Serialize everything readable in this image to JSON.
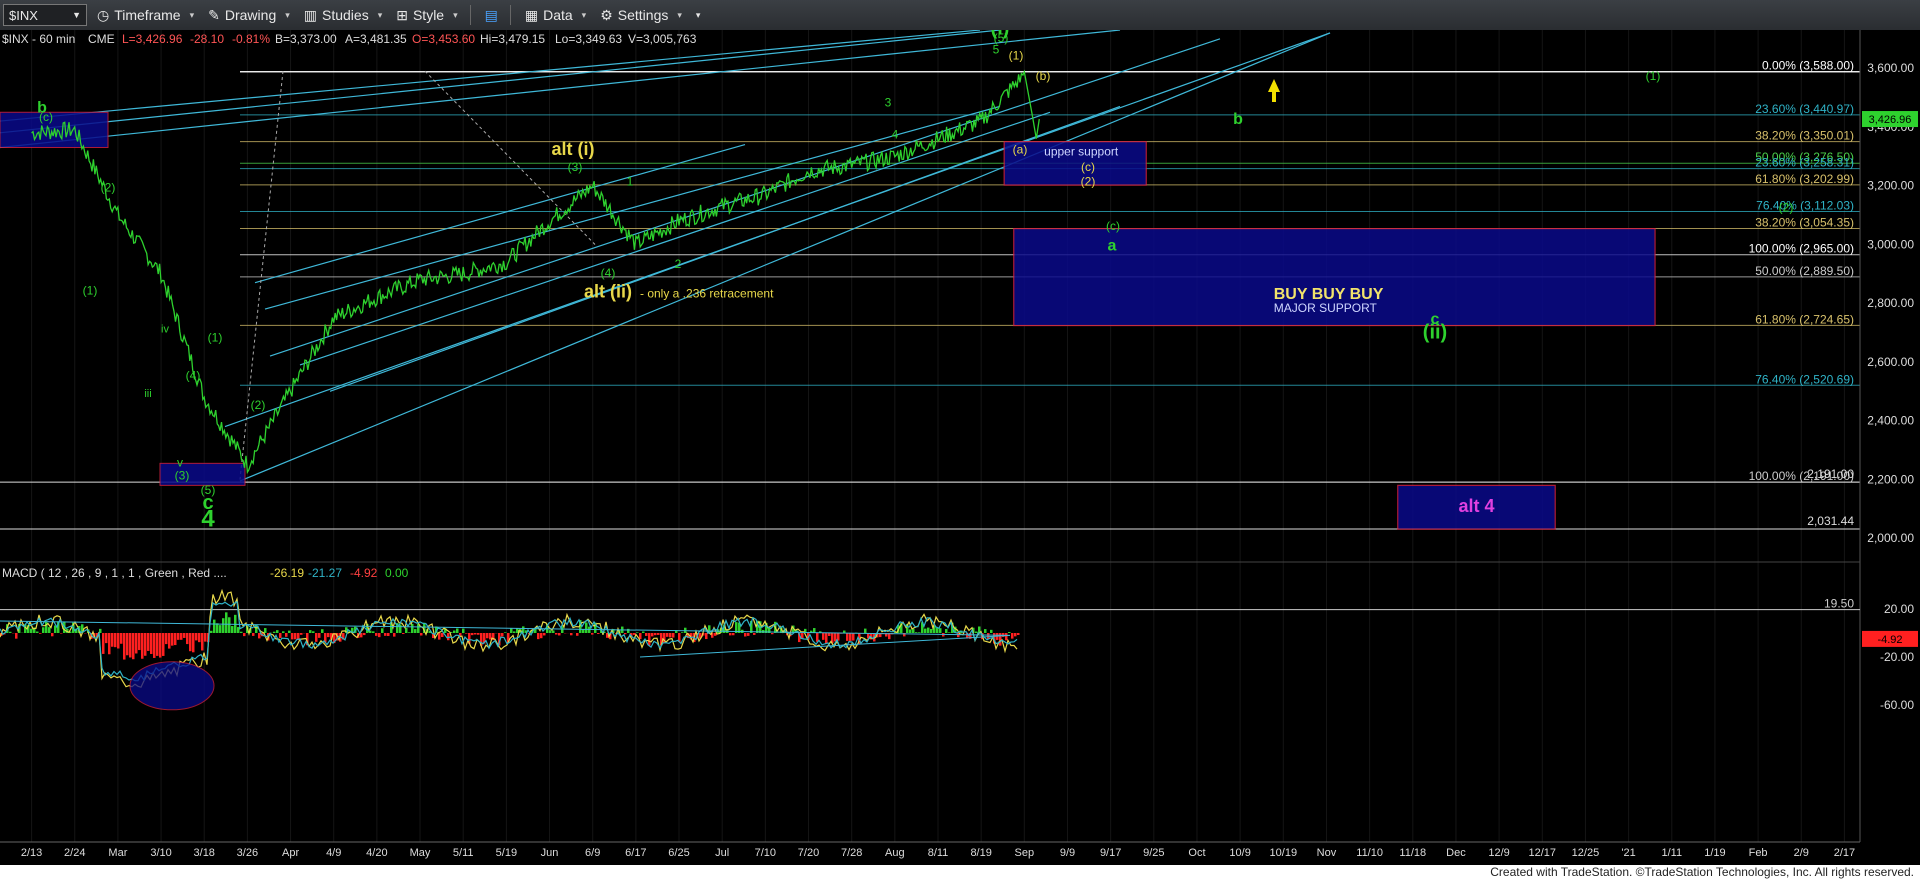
{
  "toolbar": {
    "symbol": "$INX",
    "timeframe": "Timeframe",
    "drawing": "Drawing",
    "studies": "Studies",
    "style": "Style",
    "data": "Data",
    "settings": "Settings"
  },
  "header_line": {
    "symbol": "$INX - 60 min",
    "exchange": "CME",
    "last": "L=3,426.96",
    "change": "-28.10",
    "pct": "-0.81%",
    "bid": "B=3,373.00",
    "ask": "A=3,481.35",
    "open": "O=3,453.60",
    "high": "Hi=3,479.15",
    "low": "Lo=3,349.63",
    "volume": "V=3,005,763"
  },
  "price_axis": {
    "ticks": [
      "3,600.00",
      "3,400.00",
      "3,200.00",
      "3,000.00",
      "2,800.00",
      "2,600.00",
      "2,400.00",
      "2,200.00",
      "2,000.00"
    ],
    "last_label": "3,426.96"
  },
  "fib_levels": [
    {
      "text": "0.00% (3,588.00)",
      "value": 3588,
      "color": "#ffffff",
      "line": true
    },
    {
      "text": "23.60% (3,440.97)",
      "value": 3440.97,
      "color": "#2fb3c7",
      "line": true
    },
    {
      "text": "38.20% (3,350.01)",
      "value": 3350.01,
      "color": "#d8c16b",
      "line": true
    },
    {
      "text": "50.00% (3,276.50)",
      "value": 3276.5,
      "color": "#4bd24b",
      "line": true
    },
    {
      "text": "23.60% (3,258.31)",
      "value": 3258.31,
      "color": "#2fb3c7",
      "line": true
    },
    {
      "text": "61.80% (3,202.99)",
      "value": 3202.99,
      "color": "#d8c16b",
      "line": true
    },
    {
      "text": "76.40% (3,112.03)",
      "value": 3112.03,
      "color": "#2fb3c7",
      "line": true
    },
    {
      "text": "38.20% (3,054.35)",
      "value": 3054.35,
      "color": "#d8c16b",
      "line": true
    },
    {
      "text": "100.00% (2,965.00)",
      "value": 2965,
      "color": "#ffffff",
      "line": true
    },
    {
      "text": "50.00% (2,889.50)",
      "value": 2889.5,
      "color": "#cccccc",
      "line": true
    },
    {
      "text": "61.80% (2,724.65)",
      "value": 2724.65,
      "color": "#d8c16b",
      "line": true
    },
    {
      "text": "76.40% (2,520.69)",
      "value": 2520.69,
      "color": "#2fb3c7",
      "line": true
    },
    {
      "text": "100.00% (2,191.00)",
      "value": 2191,
      "color": "#cccccc",
      "line": true
    }
  ],
  "support_lines": [
    {
      "text": "2,191.00",
      "value": 2191
    },
    {
      "text": "2,031.44",
      "value": 2031.44
    }
  ],
  "zones": [
    {
      "name": "upper-support-zone",
      "label": "upper support",
      "top": 3350,
      "bottom": 3202,
      "x0": 0.523,
      "x1": 0.597
    },
    {
      "name": "buy-zone",
      "label": "BUY BUY BUY",
      "sublabel": "MAJOR SUPPORT",
      "top": 3054,
      "bottom": 2724,
      "x0": 0.528,
      "x1": 0.862
    },
    {
      "name": "alt4-zone",
      "label": "alt 4",
      "top": 2180,
      "bottom": 2031,
      "x0": 0.728,
      "x1": 0.81
    }
  ],
  "wave_labels": {
    "green": [
      "b",
      "(c)",
      "(2)",
      "(1)",
      "iv",
      "iii",
      "(4)",
      "v",
      "(3)",
      "(5)",
      "c",
      "4",
      "(1)",
      "(2)",
      "(3)",
      "1",
      "(4)",
      "2",
      "3",
      "4",
      "5",
      "(5)",
      "(i)",
      "b",
      "(1)",
      "(2)",
      "(c)",
      "a",
      "c",
      "(ii)"
    ],
    "yellow": [
      "(1)",
      "(b)",
      "(a)",
      "(c)",
      "(2)"
    ],
    "annotations": {
      "alt_i": "alt (i)",
      "alt_ii": "alt (ii)",
      "alt_ii_note": "- only a .236 retracement",
      "b_upper": "b",
      "c_lower": "c",
      "wave4": "4"
    }
  },
  "macd": {
    "header": "MACD ( 12 , 26 , 9 , 1 , 1 , Green , Red ....",
    "v1": "-26.19",
    "v2": "-21.27",
    "v3": "-4.92",
    "v4": "0.00",
    "ticks": [
      "20.00",
      "-20.00",
      "-60.00"
    ],
    "level_label": "19.50",
    "last_label": "-4.92"
  },
  "date_axis": {
    "labels": [
      "2/13",
      "2/24",
      "Mar",
      "3/10",
      "3/18",
      "3/26",
      "Apr",
      "4/9",
      "4/20",
      "May",
      "5/11",
      "5/19",
      "Jun",
      "6/9",
      "6/17",
      "6/25",
      "Jul",
      "7/10",
      "7/20",
      "7/28",
      "Aug",
      "8/11",
      "8/19",
      "Sep",
      "9/9",
      "9/17",
      "9/25",
      "Oct",
      "10/9",
      "10/19",
      "Nov",
      "11/10",
      "11/18",
      "Dec",
      "12/9",
      "12/17",
      "12/25",
      "'21",
      "1/11",
      "1/19",
      "Feb",
      "2/9",
      "2/17"
    ]
  },
  "footer": "Created with TradeStation. ©TradeStation Technologies, Inc. All rights reserved.",
  "chart_data": {
    "type": "line",
    "title": "$INX - 60 min",
    "ylim": [
      1960,
      3730
    ],
    "price_path_dates": [
      "2/13",
      "2/24",
      "Mar",
      "3/10",
      "3/18",
      "3/26",
      "Apr",
      "4/9",
      "4/20",
      "May",
      "5/11",
      "5/19",
      "Jun",
      "6/9",
      "6/17",
      "6/25",
      "Jul",
      "7/10",
      "7/20",
      "7/28",
      "Aug",
      "8/11",
      "8/19",
      "Sep"
    ],
    "price_path_values": [
      3380,
      3390,
      3100,
      2900,
      2480,
      2250,
      2500,
      2750,
      2820,
      2880,
      2900,
      2940,
      3080,
      3200,
      3000,
      3080,
      3130,
      3170,
      3250,
      3270,
      3300,
      3360,
      3420,
      3580
    ]
  }
}
